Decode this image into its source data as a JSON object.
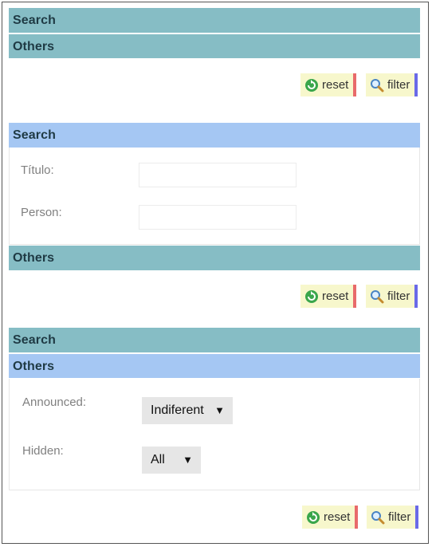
{
  "groups": [
    {
      "search_label": "Search",
      "others_label": "Others",
      "actions": {
        "reset": "reset",
        "filter": "filter"
      }
    },
    {
      "search_label": "Search",
      "others_label": "Others",
      "fields": [
        {
          "label": "Título:",
          "value": ""
        },
        {
          "label": "Person:",
          "value": ""
        }
      ],
      "actions": {
        "reset": "reset",
        "filter": "filter"
      }
    },
    {
      "search_label": "Search",
      "others_label": "Others",
      "fields": [
        {
          "label": "Announced:",
          "value": "Indiferent"
        },
        {
          "label": "Hidden:",
          "value": "All"
        }
      ],
      "actions": {
        "reset": "reset",
        "filter": "filter"
      }
    }
  ],
  "icons": {
    "reset": "refresh-icon",
    "filter": "magnifier-icon",
    "dropdown": "triangle-down"
  },
  "colors": {
    "header_teal": "#86bdc5",
    "header_blue": "#a5c7f3",
    "button_bg": "#f7f7cc",
    "reset_accent": "#e86a6a",
    "filter_accent": "#6a6ae8"
  }
}
